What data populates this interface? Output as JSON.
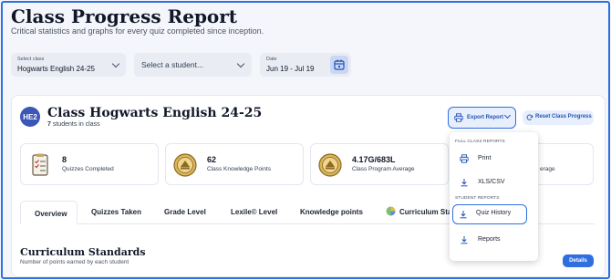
{
  "page": {
    "title": "Class Progress Report",
    "subtitle": "Critical statistics and graphs for every quiz completed since inception."
  },
  "filters": {
    "class_label": "Select class",
    "class_value": "Hogwarts English 24-25",
    "student_placeholder": "Select a student...",
    "date_label": "Date",
    "date_value": "Jun 19 - Jul 19"
  },
  "class_card": {
    "avatar": "HE2",
    "name": "Class Hogwarts English 24-25",
    "student_count": "7",
    "student_suffix": " students in class",
    "export_label": "Export Report",
    "reset_label": "Reset Class Progress"
  },
  "stats": [
    {
      "value": "8",
      "label": "Quizzes Completed"
    },
    {
      "value": "62",
      "label": "Class Knowledge Points"
    },
    {
      "value": "4.17G/683L",
      "label": "Class Program Average"
    },
    {
      "value": "",
      "label": "erage"
    }
  ],
  "tabs": [
    "Overview",
    "Quizzes Taken",
    "Grade Level",
    "Lexile© Level",
    "Knowledge points",
    "Curriculum Sta"
  ],
  "active_tab": "Overview",
  "section": {
    "title": "Curriculum Standards",
    "subtitle": "Number of points earned by each student",
    "details_label": "Details"
  },
  "export_menu": {
    "full_heading": "FULL CLASS REPORTS",
    "full_items": [
      "Print",
      "XLS/CSV"
    ],
    "student_heading": "STUDENT REPORTS",
    "student_items": [
      "Quiz History",
      "Reports"
    ],
    "selected": "Quiz History"
  },
  "colors": {
    "accent": "#2f6fe0",
    "avatar": "#3b56b8",
    "background": "#f4f6fb"
  }
}
